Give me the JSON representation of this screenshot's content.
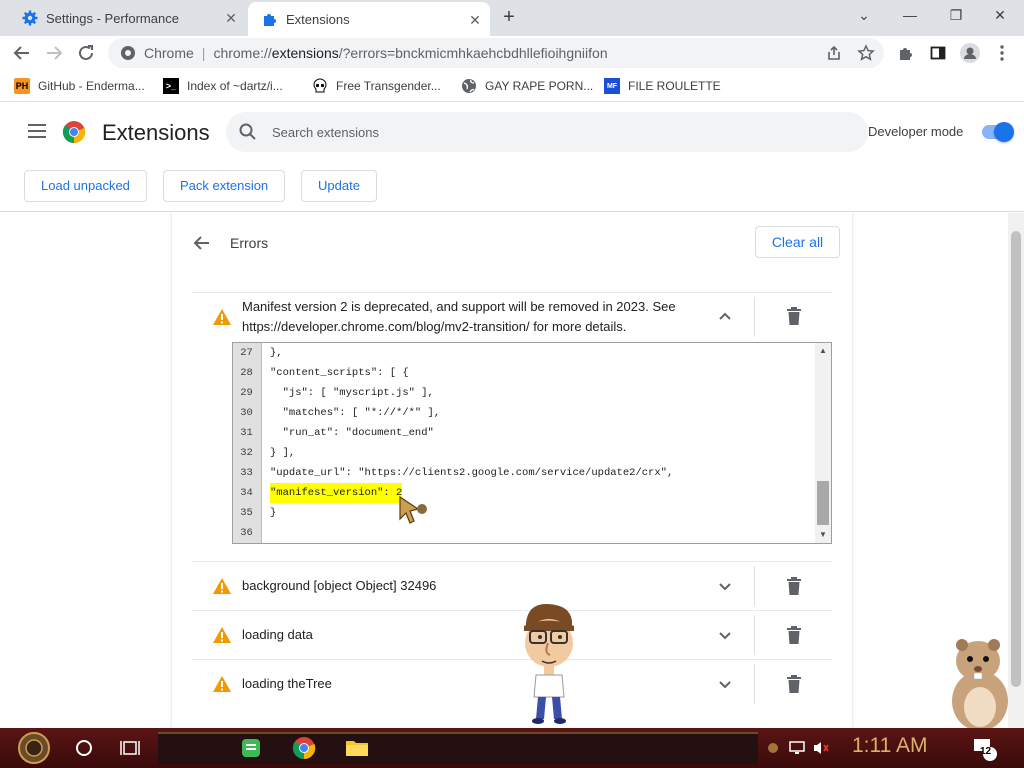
{
  "tabs": [
    {
      "title": "Settings - Performance",
      "icon": "gear-icon"
    },
    {
      "title": "Extensions",
      "icon": "puzzle-icon",
      "active": true
    }
  ],
  "toolbar": {
    "site_chip": "Chrome",
    "url_prefix": "chrome://",
    "url_main": "extensions",
    "url_rest": "/?errors=bnckmicmhkaehcbdhllefioihgniifon"
  },
  "bookmarks": [
    {
      "label": "GitHub - Enderma...",
      "icon": "PH"
    },
    {
      "label": "Index of ~dartz/i...",
      "icon": "terminal"
    },
    {
      "label": "Free Transgender...",
      "icon": "skull"
    },
    {
      "label": "GAY RAPE PORN...",
      "icon": "globe"
    },
    {
      "label": "FILE ROULETTE",
      "icon": "MF"
    }
  ],
  "header": {
    "title": "Extensions",
    "search_placeholder": "Search extensions",
    "developer_mode_label": "Developer mode",
    "developer_mode_on": true,
    "buttons": [
      "Load unpacked",
      "Pack extension",
      "Update"
    ]
  },
  "errors_panel": {
    "title": "Errors",
    "clear_all": "Clear all",
    "errors": [
      {
        "message_line1": "Manifest version 2 is deprecated, and support will be removed in 2023. See",
        "message_line2": "https://developer.chrome.com/blog/mv2-transition/ for more details.",
        "expanded": true
      },
      {
        "message": "background [object Object] 32496",
        "expanded": false
      },
      {
        "message": "loading data",
        "expanded": false
      },
      {
        "message": "loading theTree",
        "expanded": false
      }
    ],
    "code_lines": [
      {
        "n": "27",
        "text": "},"
      },
      {
        "n": "28",
        "text": "\"content_scripts\": [ {"
      },
      {
        "n": "29",
        "text": "  \"js\": [ \"myscript.js\" ],"
      },
      {
        "n": "30",
        "text": "  \"matches\": [ \"*://*/*\" ],"
      },
      {
        "n": "31",
        "text": "  \"run_at\": \"document_end\""
      },
      {
        "n": "32",
        "text": "} ],"
      },
      {
        "n": "33",
        "text": "\"update_url\": \"https://clients2.google.com/service/update2/crx\","
      },
      {
        "n": "34",
        "text": "\"manifest_version\": 2",
        "highlight": true
      },
      {
        "n": "35",
        "text": "}"
      },
      {
        "n": "36",
        "text": ""
      }
    ]
  },
  "taskbar": {
    "clock": "1:11 AM",
    "notification_count": "12"
  },
  "colors": {
    "accent": "#1a73e8",
    "warning": "#f29900",
    "highlight": "#ffff00",
    "taskbar": "#4a0f0f"
  }
}
